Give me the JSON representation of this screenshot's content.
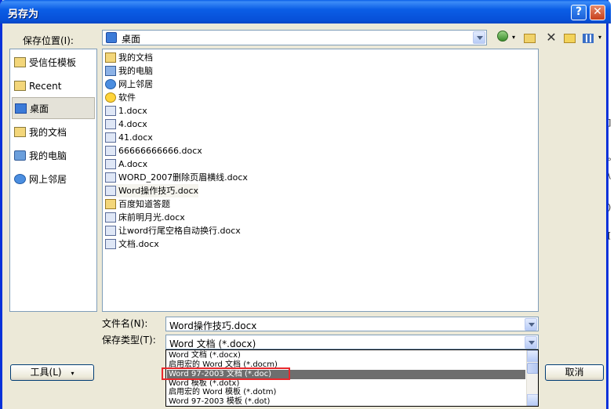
{
  "window": {
    "title": "另存为"
  },
  "titlebar": {
    "help": "?",
    "close": "✕"
  },
  "location": {
    "label": "保存位置(I):",
    "value": "桌面"
  },
  "toolbar": {
    "back": "",
    "dropdown": "▾",
    "delete": "✕"
  },
  "places": [
    {
      "label": "受信任模板",
      "icon": "folder-icon"
    },
    {
      "label": "Recent",
      "icon": "folder-icon"
    },
    {
      "label": "桌面",
      "icon": "desktop-icon",
      "active": true
    },
    {
      "label": "我的文档",
      "icon": "folder-icon"
    },
    {
      "label": "我的电脑",
      "icon": "computer-icon"
    },
    {
      "label": "网上邻居",
      "icon": "network-icon"
    }
  ],
  "files": [
    {
      "name": "我的文档",
      "icon": "fold"
    },
    {
      "name": "我的电脑",
      "icon": "comp"
    },
    {
      "name": "网上邻居",
      "icon": "net"
    },
    {
      "name": "软件",
      "icon": "star"
    },
    {
      "name": "1.docx",
      "icon": "doc"
    },
    {
      "name": "4.docx",
      "icon": "doc"
    },
    {
      "name": "41.docx",
      "icon": "doc"
    },
    {
      "name": "66666666666.docx",
      "icon": "doc"
    },
    {
      "name": "A.docx",
      "icon": "doc"
    },
    {
      "name": "WORD_2007删除页眉横线.docx",
      "icon": "doc"
    },
    {
      "name": "Word操作技巧.docx",
      "icon": "doc",
      "highlight": true
    },
    {
      "name": "百度知道答题",
      "icon": "fold"
    },
    {
      "name": "床前明月光.docx",
      "icon": "doc"
    },
    {
      "name": "让word行尾空格自动换行.docx",
      "icon": "doc"
    },
    {
      "name": "文档.docx",
      "icon": "doc"
    }
  ],
  "filename": {
    "label": "文件名(N):",
    "value": "Word操作技巧.docx"
  },
  "filetype": {
    "label": "保存类型(T):",
    "value": "Word 文档 (*.docx)",
    "options": [
      "Word 文档 (*.docx)",
      "启用宏的 Word 文档 (*.docm)",
      "Word 97-2003 文档 (*.doc)",
      "Word 模板 (*.dotx)",
      "启用宏的 Word 模板 (*.dotm)",
      "Word 97-2003 模板 (*.dot)"
    ],
    "selected_index": 2
  },
  "buttons": {
    "tools": "工具(L)",
    "tools_arrow": "▾",
    "cancel": "取消"
  },
  "background_doc": {
    "glyphs": [
      "]",
      "。",
      "\\",
      ")",
      "["
    ]
  }
}
